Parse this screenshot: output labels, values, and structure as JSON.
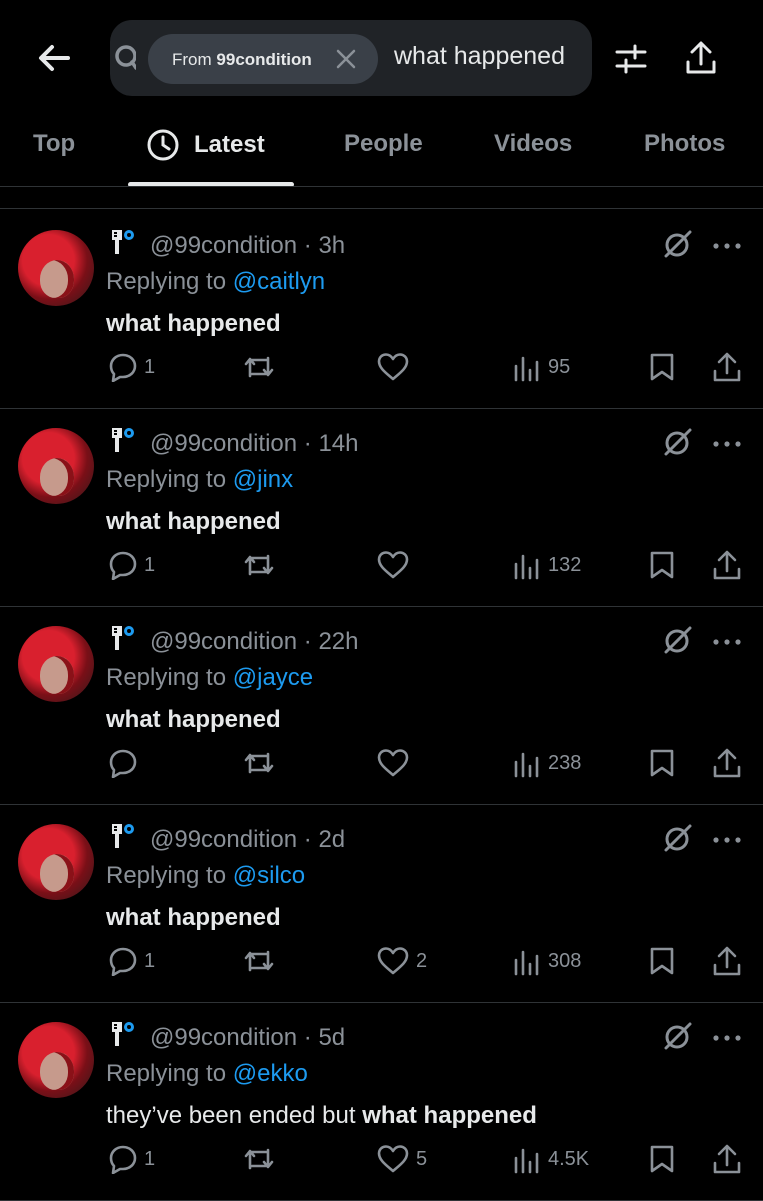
{
  "search": {
    "chip_prefix": "From",
    "chip_user": "99condition",
    "query": "what happened"
  },
  "tabs": [
    {
      "label": "Top"
    },
    {
      "label": "Latest",
      "active": true
    },
    {
      "label": "People"
    },
    {
      "label": "Videos"
    },
    {
      "label": "Photos"
    }
  ],
  "colors": {
    "accent": "#1d9bf0",
    "muted": "#8b9198",
    "background": "#000000"
  },
  "tweets": [
    {
      "handle": "@99condition · 3h",
      "replying_prefix": "Replying to",
      "mention": "@caitlyn",
      "text_prefix": "",
      "text_bold": "what happened",
      "replies": "1",
      "retweets": "",
      "likes": "",
      "views": "95"
    },
    {
      "handle": "@99condition · 14h",
      "replying_prefix": "Replying to",
      "mention": "@jinx",
      "text_prefix": "",
      "text_bold": "what happened",
      "replies": "1",
      "retweets": "",
      "likes": "",
      "views": "132"
    },
    {
      "handle": "@99condition · 22h",
      "replying_prefix": "Replying to",
      "mention": "@jayce",
      "text_prefix": "",
      "text_bold": "what happened",
      "replies": "",
      "retweets": "",
      "likes": "",
      "views": "238"
    },
    {
      "handle": "@99condition · 2d",
      "replying_prefix": "Replying to",
      "mention": "@silco",
      "text_prefix": "",
      "text_bold": "what happened",
      "replies": "1",
      "retweets": "",
      "likes": "2",
      "views": "308"
    },
    {
      "handle": "@99condition · 5d",
      "replying_prefix": "Replying to",
      "mention": "@ekko",
      "text_prefix": "they’ve been ended but ",
      "text_bold": "what happened",
      "replies": "1",
      "retweets": "",
      "likes": "5",
      "views": "4.5K"
    }
  ]
}
